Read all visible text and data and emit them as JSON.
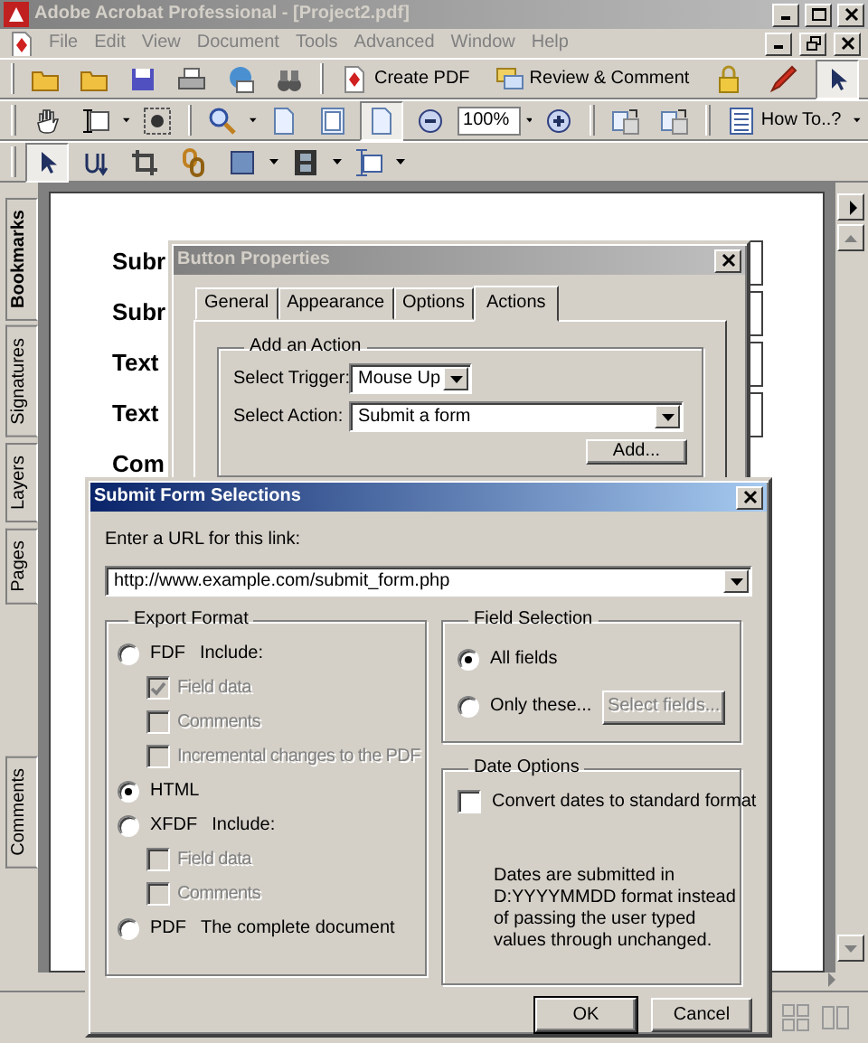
{
  "window": {
    "title": "Adobe Acrobat Professional - [Project2.pdf]"
  },
  "menu": [
    "File",
    "Edit",
    "View",
    "Document",
    "Tools",
    "Advanced",
    "Window",
    "Help"
  ],
  "toolbar": {
    "create_pdf": "Create PDF",
    "review": "Review & Comment",
    "zoom": "100%",
    "how_to": "How To..?"
  },
  "nav_tabs": [
    {
      "label": "Bookmarks",
      "selected": true
    },
    {
      "label": "Signatures",
      "selected": false
    },
    {
      "label": "Layers",
      "selected": false
    },
    {
      "label": "Pages",
      "selected": false
    },
    {
      "label": "Comments",
      "selected": false
    }
  ],
  "page": {
    "labels": [
      "Subr",
      "Subr",
      "Text",
      "Text",
      "Com"
    ]
  },
  "button_properties": {
    "title": "Button Properties",
    "tabs": [
      {
        "label": "General",
        "selected": false
      },
      {
        "label": "Appearance",
        "selected": false
      },
      {
        "label": "Options",
        "selected": false
      },
      {
        "label": "Actions",
        "selected": true
      }
    ],
    "group": "Add an Action",
    "trigger_label": "Select Trigger:",
    "trigger": "Mouse Up",
    "action_label": "Select Action:",
    "action": "Submit a form",
    "add_button": "Add..."
  },
  "submit_dialog": {
    "title": "Submit Form Selections",
    "url_label": "Enter a URL for this link:",
    "url": "http://www.example.com/submit_form.php",
    "export_format": {
      "title": "Export Format",
      "options": [
        {
          "format": "FDF",
          "detail": "Include:",
          "selected": false,
          "children": [
            {
              "label": "Field data",
              "checked": true,
              "disabled": true
            },
            {
              "label": "Comments",
              "checked": false,
              "disabled": true
            },
            {
              "label": "Incremental changes to the PDF",
              "checked": false,
              "disabled": true
            }
          ]
        },
        {
          "format": "HTML",
          "selected": true
        },
        {
          "format": "XFDF",
          "detail": "Include:",
          "selected": false,
          "children": [
            {
              "label": "Field data",
              "checked": false,
              "disabled": true
            },
            {
              "label": "Comments",
              "checked": false,
              "disabled": true
            }
          ]
        },
        {
          "format": "PDF",
          "detail": "The complete document",
          "selected": false
        }
      ]
    },
    "field_selection": {
      "title": "Field Selection",
      "options": [
        {
          "label": "All fields",
          "selected": true
        },
        {
          "label": "Only these...",
          "selected": false
        }
      ],
      "select_button": {
        "label": "Select fields...",
        "disabled": true
      }
    },
    "date_options": {
      "title": "Date Options",
      "checkbox": {
        "label": "Convert dates to standard format",
        "checked": false,
        "disabled": false
      },
      "note": "Dates are submitted in D:YYYYMMDD format instead of passing the user typed values through unchanged."
    },
    "buttons": [
      "OK",
      "Cancel"
    ]
  }
}
